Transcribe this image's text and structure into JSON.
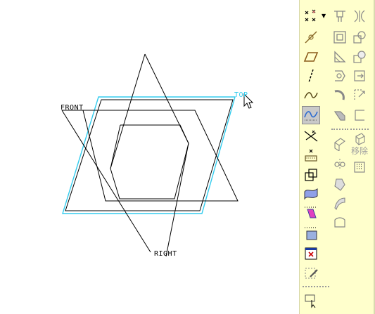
{
  "datums": {
    "front_label": "FRONT",
    "right_label": "RIGHT",
    "top_label": "TOP"
  },
  "colors": {
    "canvas_bg": "#ffffff",
    "toolbar_bg": "#ffffcc",
    "sketch_line": "#000000",
    "selected_plane": "#33ccee",
    "active_button": "#c9c9c9"
  },
  "toolbar": {
    "left_column": [
      "datum-point-icon",
      "datum-axis-icon",
      "datum-plane-icon",
      "datum-curve-icon",
      "sketched-curve-icon",
      "style-curve-icon",
      "offset-point-icon",
      "coordinate-system-icon",
      "analysis-feature-icon",
      "surface-icon",
      "ruler-icon",
      "graph-icon",
      "close-window-icon",
      "edit-feature-icon",
      "select-arrow-icon"
    ],
    "middle_column": [
      "hole-icon",
      "shell-icon",
      "draft-icon",
      "mirror-icon",
      "round-icon",
      "chamfer-icon",
      "move-copy-icon",
      "pattern-icon",
      "sweep-icon",
      "boundary-blend-icon",
      "freeform-icon"
    ],
    "right_column": [
      "rib-icon",
      "intersect-icon",
      "merge-icon",
      "extend-icon",
      "trim-icon",
      "offset-icon",
      "thicken-icon",
      "solidify-icon",
      "array-icon"
    ],
    "remove_label": "移除"
  }
}
